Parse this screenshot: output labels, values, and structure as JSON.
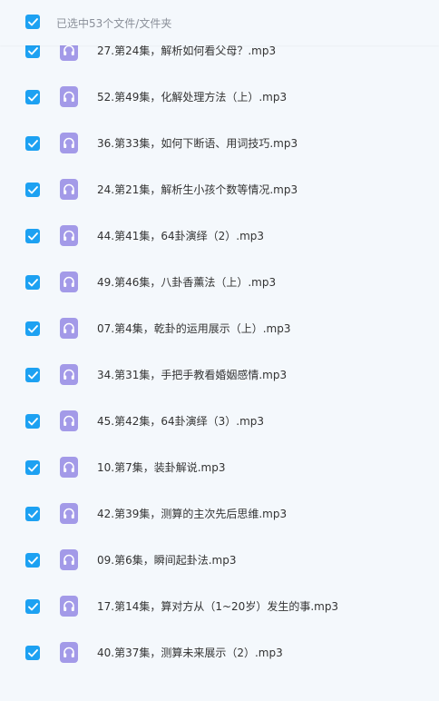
{
  "header": {
    "selection_label": "已选中53个文件/文件夹",
    "checked": true
  },
  "colors": {
    "checkbox": "#1da1f2",
    "audio_icon": "#a39ae8",
    "background": "#f4f8fc",
    "text": "#333333",
    "header_text": "#8a8f99"
  },
  "icons": {
    "checkbox": "checkmark-icon",
    "file": "audio-file-icon"
  },
  "files": [
    {
      "name": "27.第24集，解析如何看父母？.mp3",
      "checked": true
    },
    {
      "name": "52.第49集，化解处理方法（上）.mp3",
      "checked": true
    },
    {
      "name": "36.第33集，如何下断语、用词技巧.mp3",
      "checked": true
    },
    {
      "name": "24.第21集，解析生小孩个数等情况.mp3",
      "checked": true
    },
    {
      "name": "44.第41集，64卦演绎（2）.mp3",
      "checked": true
    },
    {
      "name": "49.第46集，八卦香薰法（上）.mp3",
      "checked": true
    },
    {
      "name": "07.第4集，乾卦的运用展示（上）.mp3",
      "checked": true
    },
    {
      "name": "34.第31集，手把手教看婚姻感情.mp3",
      "checked": true
    },
    {
      "name": "45.第42集，64卦演绎（3）.mp3",
      "checked": true
    },
    {
      "name": "10.第7集，装卦解说.mp3",
      "checked": true
    },
    {
      "name": "42.第39集，测算的主次先后思维.mp3",
      "checked": true
    },
    {
      "name": "09.第6集，瞬间起卦法.mp3",
      "checked": true
    },
    {
      "name": "17.第14集，算对方从（1~20岁）发生的事.mp3",
      "checked": true
    },
    {
      "name": "40.第37集，测算未来展示（2）.mp3",
      "checked": true
    }
  ]
}
